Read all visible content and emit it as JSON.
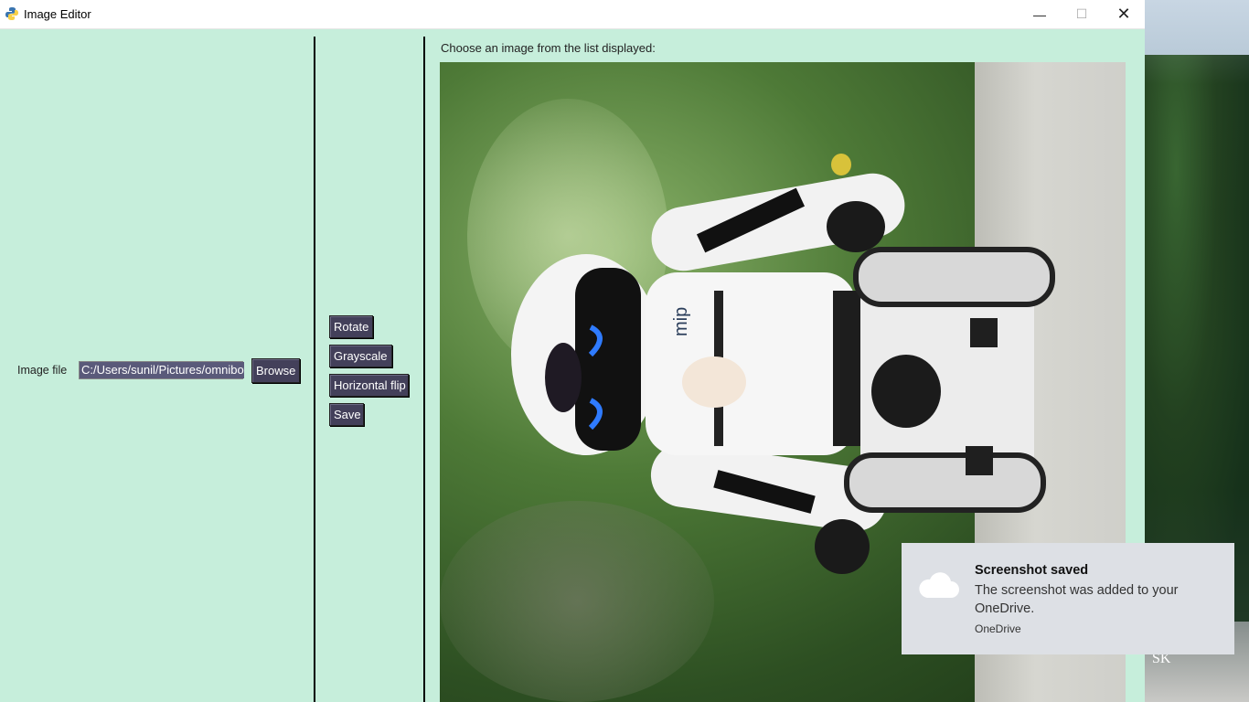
{
  "window": {
    "title": "Image Editor",
    "controls": {
      "minimize": "—",
      "maximize": "☐",
      "close": "✕"
    }
  },
  "left_pane": {
    "image_file_label": "Image file",
    "path_value": "C:/Users/sunil/Pictures/omnibot",
    "browse_label": "Browse"
  },
  "tools": {
    "rotate_label": "Rotate",
    "grayscale_label": "Grayscale",
    "hflip_label": "Horizontal flip",
    "save_label": "Save"
  },
  "viewer": {
    "instruction": "Choose an image from the list displayed:",
    "robot_mark": "mip"
  },
  "toast": {
    "title": "Screenshot saved",
    "body": "The screenshot was added to your OneDrive.",
    "source": "OneDrive",
    "icon": "cloud-icon"
  },
  "desktop": {
    "watermark": "SK"
  },
  "colors": {
    "window_bg": "#c6eedb",
    "button_bg": "#43405a",
    "toast_bg": "#dde0e5"
  }
}
